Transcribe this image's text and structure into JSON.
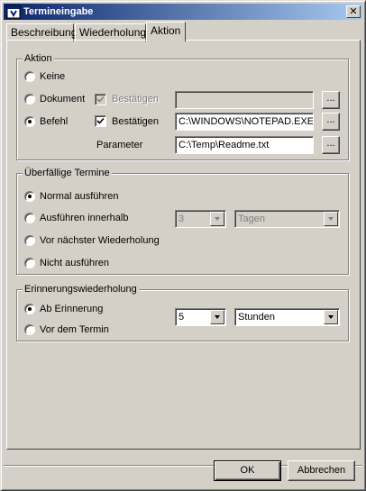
{
  "window": {
    "title": "Termineingabe",
    "close_label": "✕"
  },
  "tabs": [
    {
      "label": "Beschreibung",
      "active": false
    },
    {
      "label": "Wiederholung",
      "active": false
    },
    {
      "label": "Aktion",
      "active": true
    }
  ],
  "aktion": {
    "title": "Aktion",
    "keine_label": "Keine",
    "dokument_label": "Dokument",
    "dokument_confirm_label": "Bestätigen",
    "dokument_value": "",
    "befehl_label": "Befehl",
    "befehl_confirm_label": "Bestätigen",
    "befehl_value": "C:\\WINDOWS\\NOTEPAD.EXE",
    "parameter_label": "Parameter",
    "parameter_value": "C:\\Temp\\Readme.txt",
    "browse_label": "...",
    "selected": "Befehl"
  },
  "overdue": {
    "title": "Überfällige Termine",
    "normal_label": "Normal ausführen",
    "within_label": "Ausführen innerhalb",
    "within_value": "3",
    "within_unit": "Tagen",
    "before_next_label": "Vor nächster Wiederholung",
    "dont_label": "Nicht ausführen",
    "selected": "Normal ausführen"
  },
  "reminder": {
    "title": "Erinnerungswiederholung",
    "from_label": "Ab Erinnerung",
    "before_label": "Vor dem Termin",
    "value": "5",
    "unit": "Stunden",
    "selected": "Ab Erinnerung"
  },
  "footer": {
    "ok_label": "OK",
    "cancel_label": "Abbrechen"
  },
  "colors": {
    "title_start": "#0a246a",
    "title_end": "#a6caf0",
    "face": "#d4d0c8"
  }
}
